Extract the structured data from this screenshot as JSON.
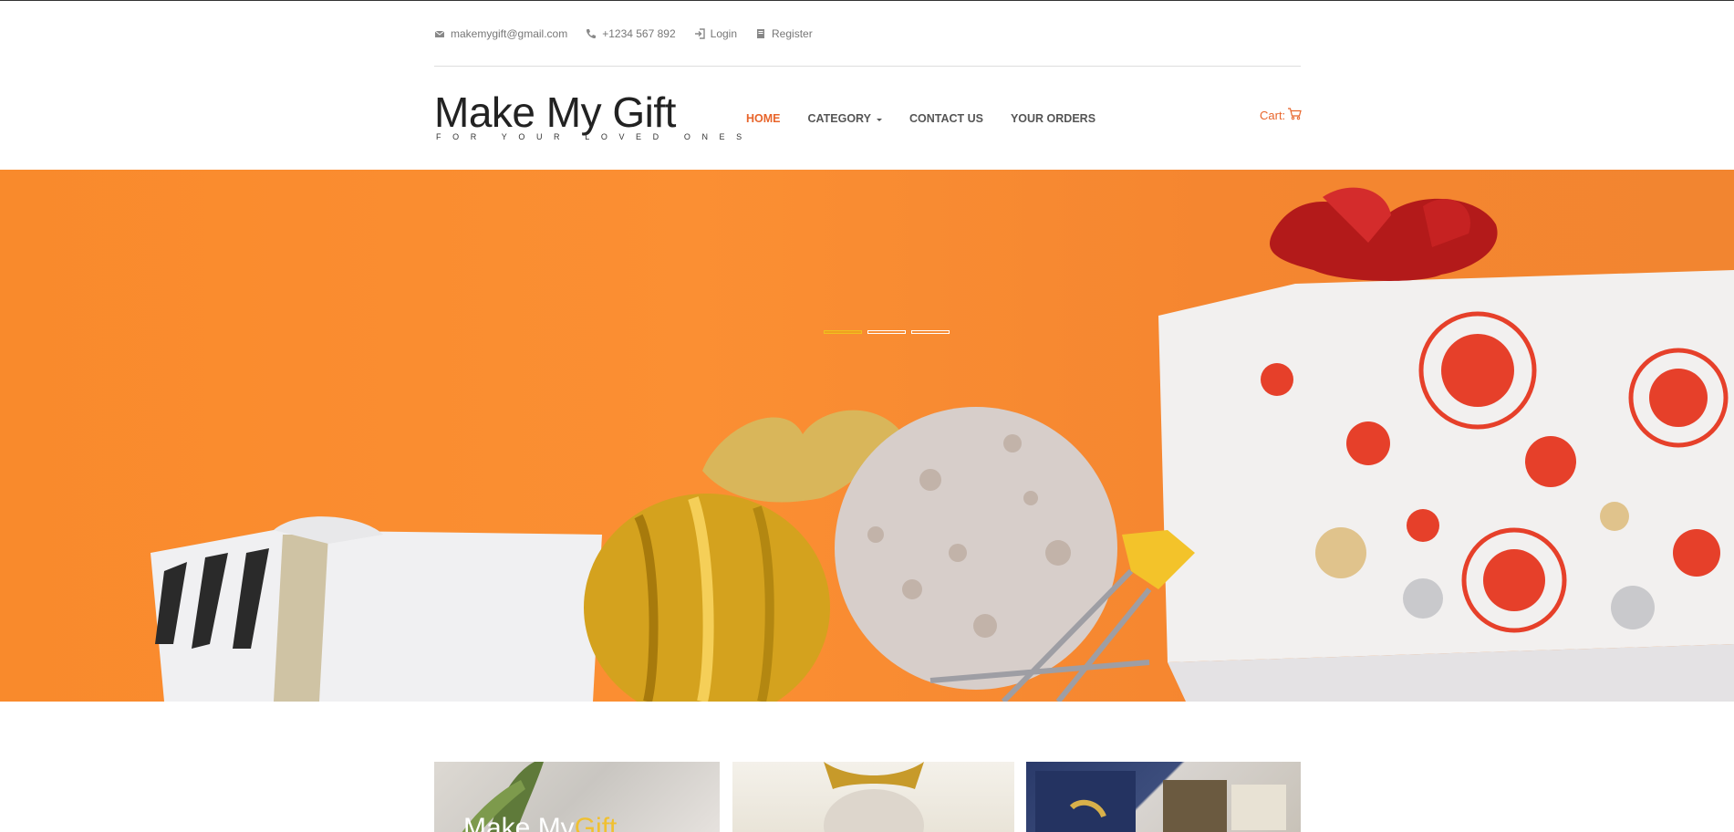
{
  "topbar": {
    "email": "makemygift@gmail.com",
    "phone": "+1234 567 892",
    "login": "Login",
    "register": "Register"
  },
  "logo": {
    "title": "Make My Gift",
    "tagline": "FOR YOUR LOVED ONES"
  },
  "nav": {
    "home": "HOME",
    "category": "CATEGORY",
    "contact": "CONTACT US",
    "orders": "YOUR ORDERS"
  },
  "cart": {
    "label": "Cart:"
  },
  "hero": {
    "slide_count": 3,
    "active_slide": 1
  },
  "products": {
    "thumb1_overlay_a": "Make My",
    "thumb1_overlay_b": "Gift"
  },
  "colors": {
    "accent": "#e8652b",
    "hero_bg": "#fb8f33"
  },
  "icons": [
    "envelope-icon",
    "phone-icon",
    "login-icon",
    "register-icon",
    "cart-icon"
  ]
}
